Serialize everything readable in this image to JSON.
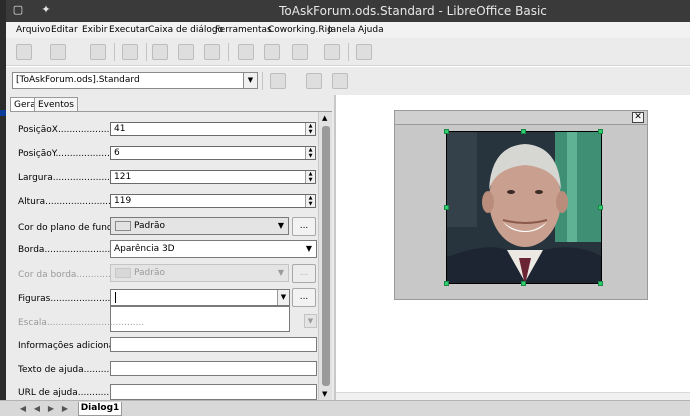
{
  "window": {
    "title": "ToAskForum.ods.Standard - LibreOffice Basic"
  },
  "menu": [
    "Arquivo",
    "Editar",
    "Exibir",
    "Executar",
    "Caixa de diálogo",
    "Ferramentas",
    "Coworking.Rio",
    "Janela",
    "Ajuda"
  ],
  "library_selector": {
    "value": "[ToAskForum.ods].Standard"
  },
  "properties": {
    "tabs": [
      "Geral",
      "Eventos"
    ],
    "fields": {
      "posicao_x": {
        "label": "PosiçãoX.............................",
        "value": "41"
      },
      "posicao_y": {
        "label": "PosiçãoY............................",
        "value": "6"
      },
      "largura": {
        "label": "Largura...............................",
        "value": "121"
      },
      "altura": {
        "label": "Altura................................",
        "value": "119"
      },
      "cor_fundo": {
        "label": "Cor do plano de fundo...",
        "value": "Padrão"
      },
      "borda": {
        "label": "Borda..................................",
        "value": "Aparência 3D"
      },
      "cor_borda": {
        "label": "Cor da borda....................",
        "value": "Padrão"
      },
      "figuras": {
        "label": "Figuras...............................",
        "value": ""
      },
      "escala": {
        "label": "Escala.................................."
      },
      "info_adicionais": {
        "label": "Informações adicionais...",
        "value": ""
      },
      "texto_ajuda": {
        "label": "Texto de ajuda.....................",
        "value": ""
      },
      "url_ajuda": {
        "label": "URL de ajuda......................",
        "value": ""
      }
    },
    "browse_label": "..."
  },
  "dialog_tab": {
    "label": "Dialog1"
  },
  "colors": {
    "titlebar": "#3a3a3a",
    "handle": "#2fcf6f",
    "panel": "#ebebeb"
  },
  "icons": [
    "app-icon",
    "pin-icon",
    "close-icon",
    "dropdown-arrow-icon",
    "spin-arrows-icon"
  ]
}
